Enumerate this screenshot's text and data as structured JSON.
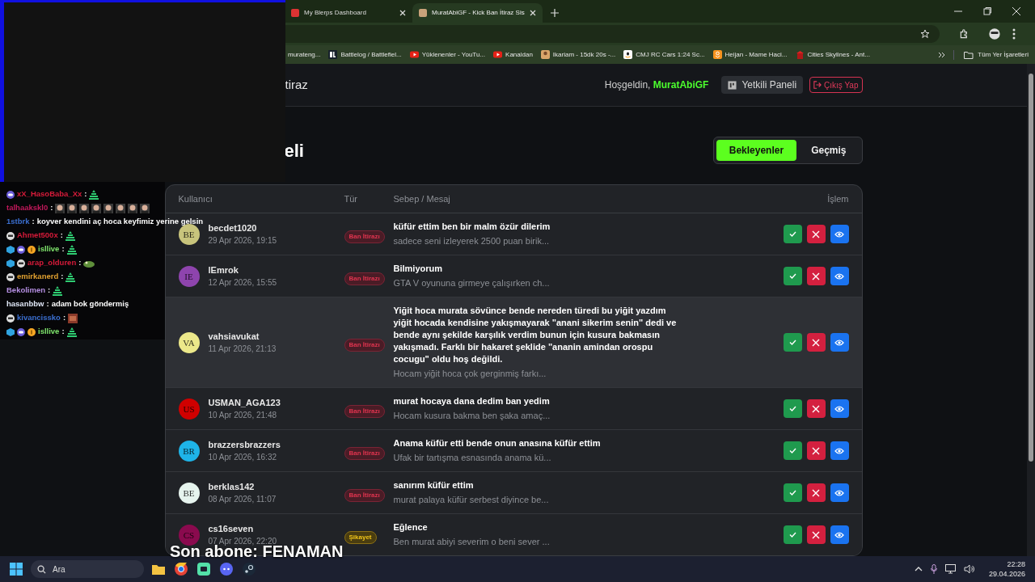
{
  "browser": {
    "tabs": [
      {
        "title": "My Blerps Dashboard",
        "selected": false
      },
      {
        "title": "MuratAbiGF - Kick Ban İtiraz Sis",
        "selected": true
      }
    ],
    "bookmarks": [
      {
        "kind": "none",
        "label": "murateng..."
      },
      {
        "kind": "bl",
        "label": "Battlelog / Battlefiel..."
      },
      {
        "kind": "yt",
        "label": "Yüklenenler - YouTu..."
      },
      {
        "kind": "yt",
        "label": "Kanaldan"
      },
      {
        "kind": "game",
        "label": "Ikariam - 15dk 20s -..."
      },
      {
        "kind": "amazon",
        "label": "CMJ RC Cars 1:24 Sc..."
      },
      {
        "kind": "ok",
        "label": "Heijan - Mame Haci..."
      },
      {
        "kind": "red",
        "label": "Cities Skylines - Ant..."
      }
    ],
    "all_bookmarks": "Tüm Yer İşaretleri"
  },
  "header": {
    "brand": "tiraz",
    "welcome": "Hoşgeldin,",
    "user": "MuratAbiGF",
    "panel_button": "Yetkili Paneli",
    "logout_button": "Çıkış Yap"
  },
  "page_title": "eli",
  "filters": [
    {
      "label": "Bekleyenler",
      "selected": true
    },
    {
      "label": "Geçmiş",
      "selected": false
    }
  ],
  "table": {
    "columns": [
      "Kullanıcı",
      "Tür",
      "Sebep / Mesaj",
      "İşlem"
    ],
    "rows": [
      {
        "initials": "BE",
        "color": "#c8c47c",
        "user": "becdet1020",
        "date": "29 Apr 2026, 19:15",
        "type": "Ban İtirazı",
        "kind": "appeal",
        "title": "küfür ettim ben bir malm özür dilerim",
        "preview": "sadece seni izleyerek 2500 puan birik...",
        "highlighted": false
      },
      {
        "initials": "IE",
        "color": "#8e44ad",
        "user": "lEmrok",
        "date": "12 Apr 2026, 15:55",
        "type": "Ban İtirazı",
        "kind": "appeal",
        "title": "Bilmiyorum",
        "preview": "GTA V oyununa girmeye çalışırken ch...",
        "highlighted": false
      },
      {
        "initials": "VA",
        "color": "#ece88a",
        "user": "vahsiavukat",
        "date": "11 Apr 2026, 21:13",
        "type": "Ban İtirazı",
        "kind": "appeal",
        "title": "Yiğit hoca murata sövünce bende nereden türedi bu yiğit yazdım yiğit hocada kendisine yakışmayarak \"anani sikerim senin\" dedi ve bende aynı şekilde karşılık verdim bunun için kusura bakmasın yakışmadı. Farklı bir hakaret şeklide \"ananin amindan orospu cocugu\" oldu hoş değildi.",
        "preview": "Hocam yiğit hoca çok gerginmiş farkı...",
        "highlighted": true
      },
      {
        "initials": "US",
        "color": "#d00000",
        "user": "USMAN_AGA123",
        "date": "10 Apr 2026, 21:48",
        "type": "Ban İtirazı",
        "kind": "appeal",
        "title": "murat hocaya dana dedim ban yedim",
        "preview": "Hocam kusura bakma ben şaka amaç...",
        "highlighted": false
      },
      {
        "initials": "BR",
        "color": "#1eb4e8",
        "user": "brazzersbrazzers",
        "date": "10 Apr 2026, 16:32",
        "type": "Ban İtirazı",
        "kind": "appeal",
        "title": "Anama küfür etti bende onun anasına küfür ettim",
        "preview": "Ufak bir tartışma esnasında anama kü...",
        "highlighted": false
      },
      {
        "initials": "BE",
        "color": "#e6f4ee",
        "user": "berklas142",
        "date": "08 Apr 2026, 11:07",
        "type": "Ban İtirazı",
        "kind": "appeal",
        "title": "sanırım küfür ettim",
        "preview": "murat palaya küfür serbest diyince be...",
        "highlighted": false
      },
      {
        "initials": "CS",
        "color": "#8a0a4e",
        "user": "cs16seven",
        "date": "07 Apr 2026, 22:20",
        "type": "Şikayet",
        "kind": "complaint",
        "title": "Eğlence",
        "preview": "Ben murat abiyi severim o beni sever ...",
        "highlighted": false
      }
    ]
  },
  "chat": [
    {
      "kind": "maskpyramid",
      "name": "xX_HasoBaba_Xx",
      "color": "#d81b3a",
      "sep": ":"
    },
    {
      "kind": "portraits",
      "name": "talhaakskl0",
      "color": "#c2185b",
      "sep": ":"
    },
    {
      "kind": "plain",
      "name": "1stbrk",
      "color": "#3b6fd0",
      "sep": ":",
      "message": "koyver kendini aç hoca keyfimiz yerine gelsin"
    },
    {
      "kind": "facepyramid",
      "name": "Ahmet500x",
      "color": "#d81b3a",
      "sep": ":"
    },
    {
      "kind": "triopyramid",
      "name": "isllive",
      "color": "#7ee36b",
      "sep": ":"
    },
    {
      "kind": "duofrog",
      "name": "arap_olduren",
      "color": "#d81b3a",
      "sep": ":"
    },
    {
      "kind": "facepyramid",
      "name": "emirkanerd",
      "color": "#e0a030",
      "sep": ":"
    },
    {
      "kind": "pyramid",
      "name": "Bekolimen",
      "color": "#b38de0",
      "sep": ":"
    },
    {
      "kind": "plain",
      "name": "hasanbbw",
      "color": "#dfe6f5",
      "sep": ":",
      "message": "adam bok göndermiş"
    },
    {
      "kind": "faceanimal",
      "name": "kivancissko",
      "color": "#3b6fd0",
      "sep": ":"
    },
    {
      "kind": "triopyramid",
      "name": "isllive",
      "color": "#7ee36b",
      "sep": ":"
    }
  ],
  "last_subscriber": "Son abone: FENAMAN",
  "taskbar": {
    "search": "Ara",
    "time": "22:28",
    "date": "29.04.2026"
  }
}
